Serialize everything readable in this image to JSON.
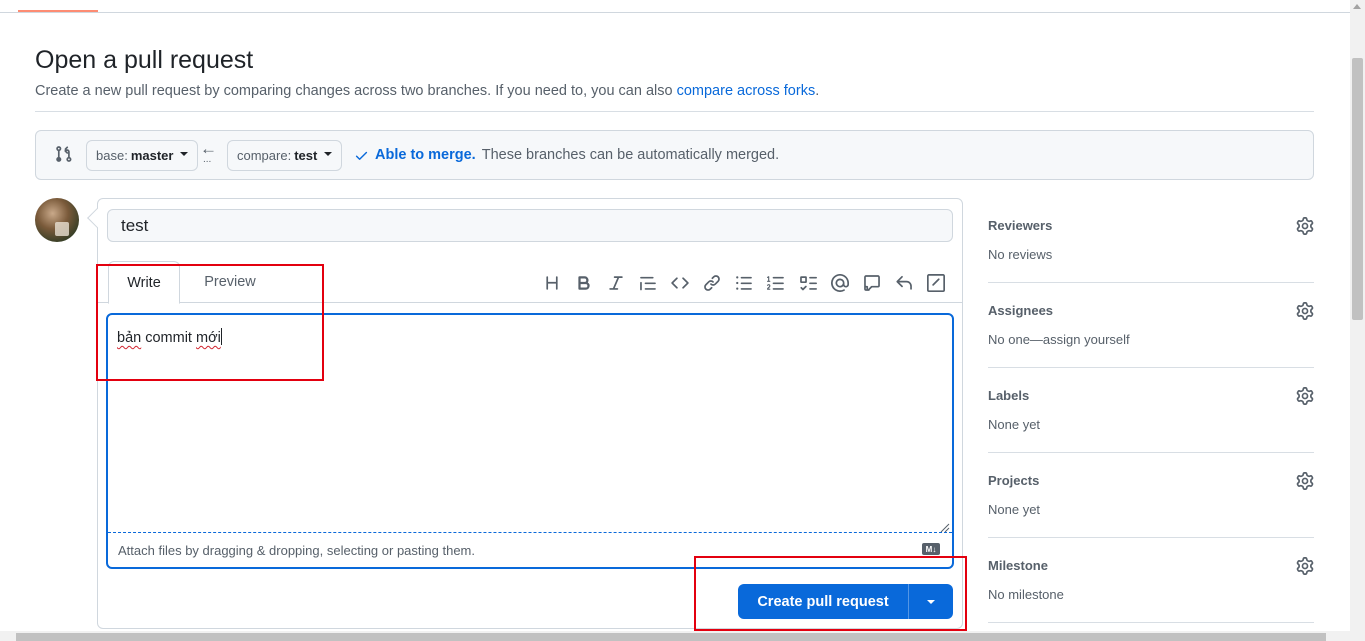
{
  "page": {
    "title": "Open a pull request",
    "subtitle_prefix": "Create a new pull request by comparing changes across two branches. If you need to, you can also ",
    "subtitle_link": "compare across forks",
    "subtitle_suffix": "."
  },
  "range": {
    "base_prefix": "base:",
    "base_branch": "master",
    "compare_prefix": "compare:",
    "compare_branch": "test",
    "merge_status_strong": "Able to merge.",
    "merge_status_text": "These branches can be automatically merged."
  },
  "editor": {
    "title_value": "test",
    "tab_write": "Write",
    "tab_preview": "Preview",
    "body_word1": "bản",
    "body_word2": "commit",
    "body_word3": "mới",
    "attach_hint": "Attach files by dragging & dropping, selecting or pasting them.",
    "markdown_badge": "M↓",
    "toolbar_icons": [
      "heading-icon",
      "bold-icon",
      "italic-icon",
      "quote-icon",
      "code-icon",
      "link-icon",
      "unordered-list-icon",
      "ordered-list-icon",
      "task-list-icon",
      "mention-icon",
      "reference-icon",
      "reply-icon",
      "slash-command-icon"
    ]
  },
  "actions": {
    "create_label": "Create pull request"
  },
  "sidebar": {
    "sections": [
      {
        "heading": "Reviewers",
        "value": "No reviews"
      },
      {
        "heading": "Assignees",
        "value": "No one—assign yourself"
      },
      {
        "heading": "Labels",
        "value": "None yet"
      },
      {
        "heading": "Projects",
        "value": "None yet"
      },
      {
        "heading": "Milestone",
        "value": "No milestone"
      }
    ]
  },
  "colors": {
    "accent": "#0969da",
    "annotation": "#e3000f",
    "success": "#1a7f37"
  }
}
